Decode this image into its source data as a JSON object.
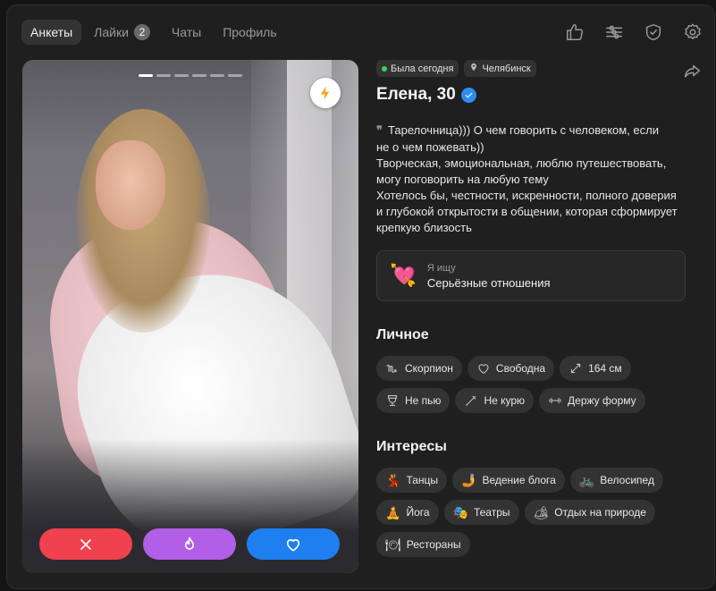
{
  "nav": {
    "tabs": [
      {
        "label": "Анкеты",
        "active": true
      },
      {
        "label": "Лайки",
        "badge": "2"
      },
      {
        "label": "Чаты"
      },
      {
        "label": "Профиль"
      }
    ],
    "tools": [
      "thumb-up-icon",
      "filters-icon",
      "shield-icon",
      "settings-icon"
    ]
  },
  "photo": {
    "indicator_count": 6,
    "indicator_active": 1,
    "boost_icon": "lightning-icon"
  },
  "actions": {
    "dislike_icon": "close-icon",
    "super_icon": "flame-icon",
    "like_icon": "heart-icon",
    "colors": {
      "dislike": "#f0424e",
      "super": "#b25ee6",
      "like": "#1e7ff0"
    }
  },
  "profile": {
    "status": "Была сегодня",
    "city": "Челябинск",
    "name_age": "Елена, 30",
    "bio": "Тарелочница))) О чем говорить с человеком, если\nне о чем пожевать))\nТворческая, эмоциональная, люблю путешествовать,\nмогу поговорить на любую тему\nХотелось бы, честности, искренности, полного доверия\nи глубокой открытости в общении, которая сформирует\nкрепкую близость",
    "looking_label": "Я ищу",
    "looking_value": "Серьёзные отношения"
  },
  "personal": {
    "title": "Личное",
    "items": [
      {
        "icon": "scorpio-icon",
        "label": "Скорпион"
      },
      {
        "icon": "heart-outline-icon",
        "label": "Свободна"
      },
      {
        "icon": "height-icon",
        "label": "164 см"
      },
      {
        "icon": "glass-icon",
        "label": "Не пью"
      },
      {
        "icon": "no-smoking-icon",
        "label": "Не курю"
      },
      {
        "icon": "dumbbell-icon",
        "label": "Держу форму"
      }
    ]
  },
  "interests": {
    "title": "Интересы",
    "items": [
      {
        "emoji": "💃",
        "label": "Танцы"
      },
      {
        "emoji": "🤳",
        "label": "Ведение блога"
      },
      {
        "emoji": "🚲",
        "label": "Велосипед"
      },
      {
        "emoji": "🧘",
        "label": "Йога"
      },
      {
        "emoji": "🎭",
        "label": "Театры"
      },
      {
        "emoji": "🏕",
        "label": "Отдых на природе"
      },
      {
        "emoji": "🍽",
        "label": "Рестораны"
      }
    ]
  }
}
